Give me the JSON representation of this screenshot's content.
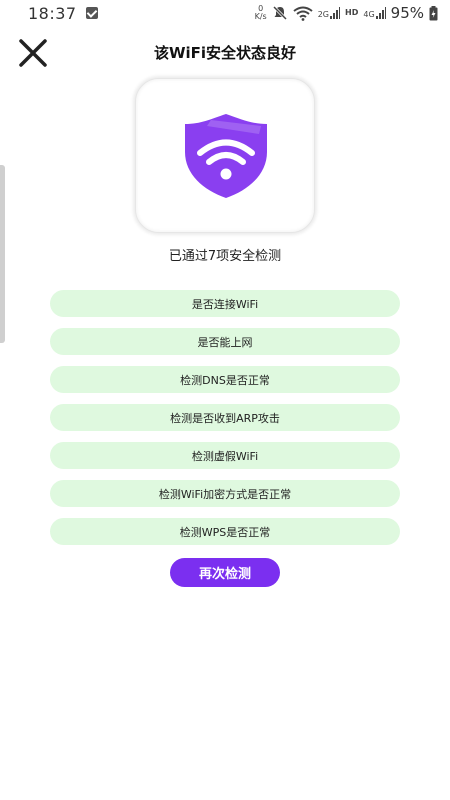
{
  "status_bar": {
    "time": "18:37",
    "net_speed_value": "0",
    "net_speed_unit": "K/s",
    "sim1_label": "2G",
    "hd_label": "HD",
    "sim2_label": "4G",
    "battery": "95%"
  },
  "header": {
    "title": "该WiFi安全状态良好"
  },
  "summary": "已通过7项安全检测",
  "checks": [
    "是否连接WiFi",
    "是否能上网",
    "检测DNS是否正常",
    "检测是否收到ARP攻击",
    "检测虚假WiFi",
    "检测WiFi加密方式是否正常",
    "检测WPS是否正常"
  ],
  "retry_button": "再次检测",
  "colors": {
    "accent": "#7b2ff0",
    "check_bg": "#dff9df"
  }
}
